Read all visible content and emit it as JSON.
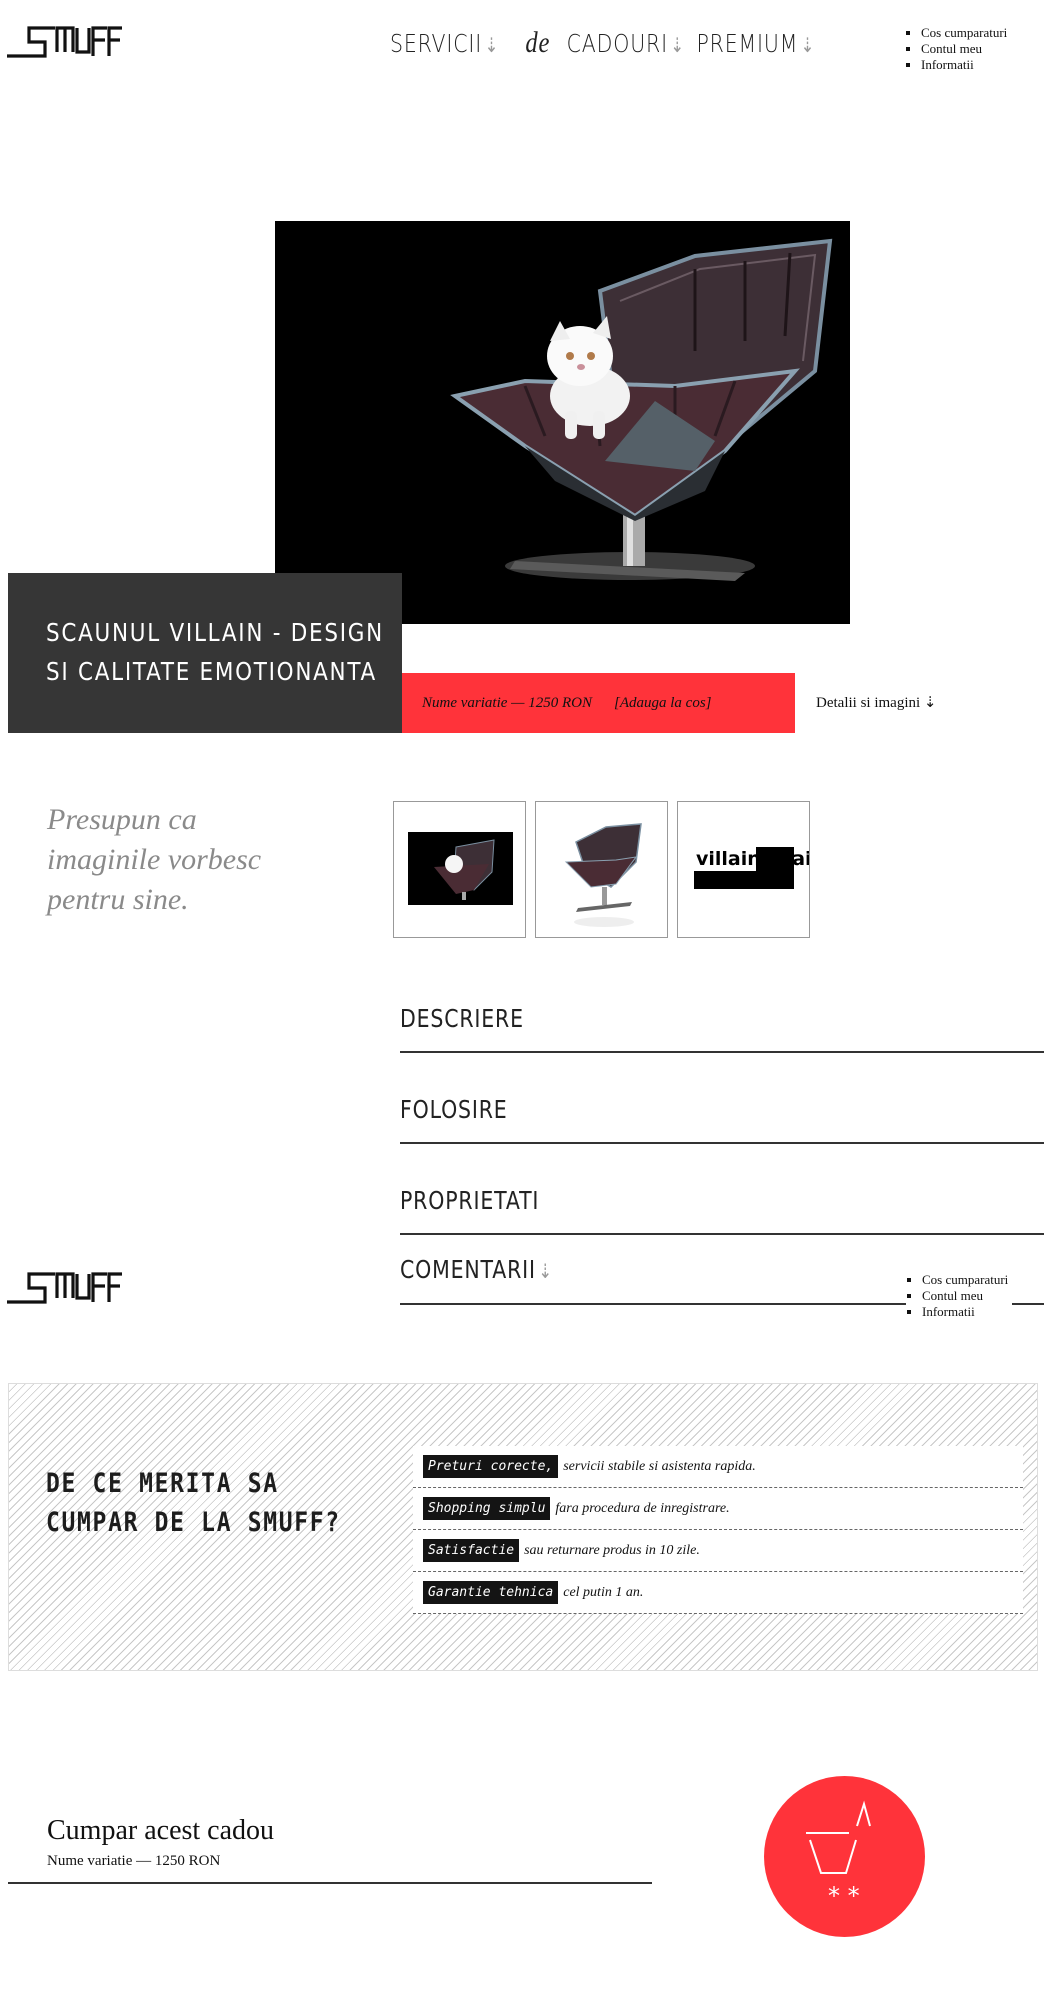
{
  "nav": {
    "items": [
      {
        "label": "SERVICII",
        "arrow": "⇣"
      },
      {
        "connector": "de"
      },
      {
        "label": "CADOURI",
        "arrow": "⇣"
      },
      {
        "label": "PREMIUM",
        "arrow": "⇣"
      }
    ]
  },
  "account_links": [
    "Cos cumparaturi",
    "Contul meu",
    "Informatii"
  ],
  "hero": {
    "title_line1": "SCAUNUL VILLAIN - DESIGN",
    "title_line2": "SI CALITATE EMOTIONANTA",
    "variation_price": "Nume variatie — 1250 RON",
    "add_to_cart": "[Adauga la cos]",
    "details_link": "Detalii si imagini ⇣"
  },
  "gallery": {
    "tagline": "Presupun ca imaginile vorbesc pentru sine.",
    "thumb3_logo": "villain chair"
  },
  "accordion": {
    "descriere": "DESCRIERE",
    "folosire": "FOLOSIRE",
    "proprietati": "PROPRIETATI",
    "comentarii": "COMENTARII",
    "comentarii_arrow": "⇣"
  },
  "why": {
    "title_line1": "DE CE MERITA SA",
    "title_line2": "CUMPAR DE LA SMUFF?",
    "rows": [
      {
        "tag": "Preturi corecte,",
        "text": "servicii stabile si asistenta rapida."
      },
      {
        "tag": "Shopping simplu",
        "text": "fara procedura de inregistrare."
      },
      {
        "tag": "Satisfactie",
        "text": "sau returnare produs in 10 zile."
      },
      {
        "tag": "Garantie tehnica",
        "text": "cel putin 1 an."
      }
    ]
  },
  "purchase": {
    "title": "Cumpar acest cadou",
    "subtitle": "Nume variatie — 1250 RON"
  },
  "colors": {
    "accent": "#ff333a",
    "dark": "#363636"
  }
}
